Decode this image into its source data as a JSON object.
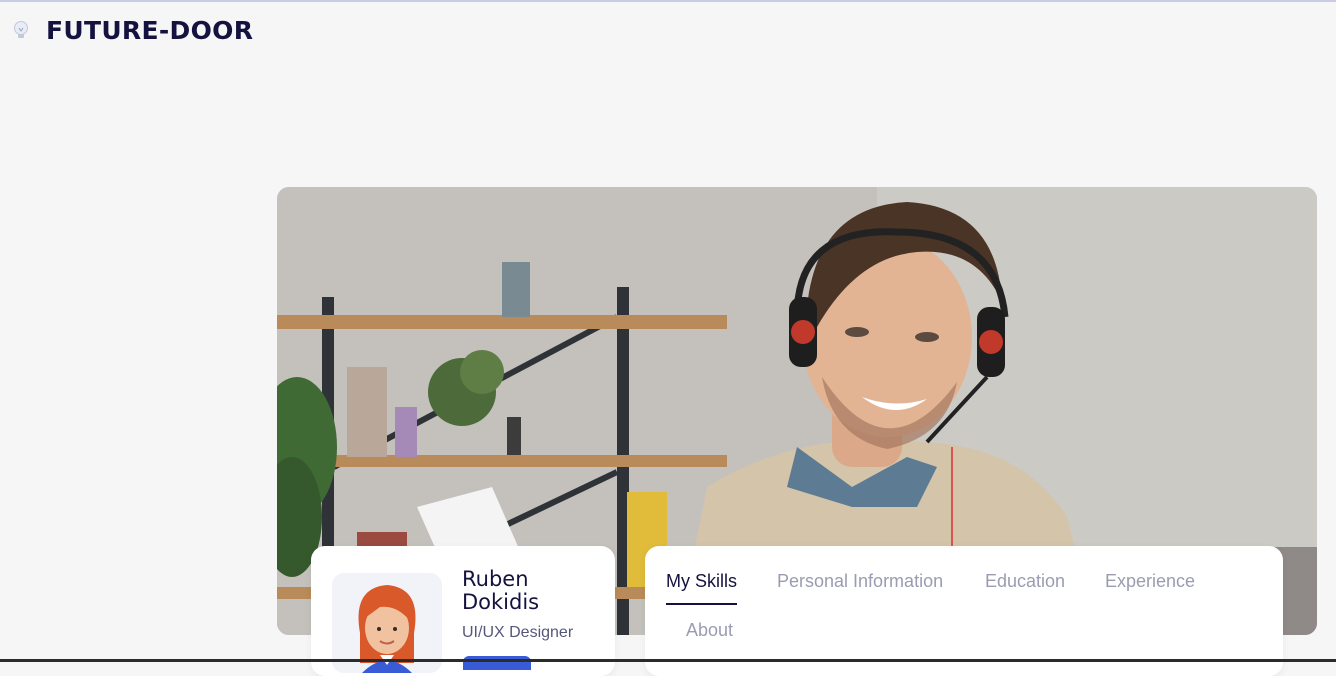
{
  "header": {
    "brand": "FUTURE-DOOR",
    "logo_icon": "lightbulb-icon"
  },
  "hero": {
    "image": "man-with-headset-photo"
  },
  "profile": {
    "name": "Ruben Dokidis",
    "role": "UI/UX Designer",
    "avatar_icon": "woman-avatar-icon",
    "accent_color": "#3a5bd6"
  },
  "tabs": [
    {
      "label": "My Skills",
      "active": true
    },
    {
      "label": "Personal Information",
      "active": false
    },
    {
      "label": "Education",
      "active": false
    },
    {
      "label": "Experience",
      "active": false
    },
    {
      "label": "About",
      "active": false
    }
  ],
  "colors": {
    "brand_text": "#15123f",
    "inactive_tab": "#9a9cb2",
    "background": "#f6f6f6"
  }
}
